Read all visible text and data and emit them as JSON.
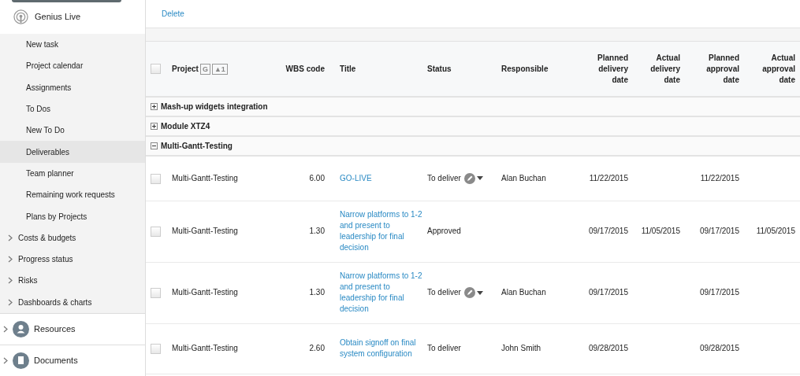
{
  "sidebar": {
    "app": {
      "label": "Genius Live"
    },
    "items": [
      {
        "label": "New task",
        "selected": false
      },
      {
        "label": "Project calendar",
        "selected": false
      },
      {
        "label": "Assignments",
        "selected": false
      },
      {
        "label": "To Dos",
        "selected": false
      },
      {
        "label": "New To Do",
        "selected": false
      },
      {
        "label": "Deliverables",
        "selected": true
      },
      {
        "label": "Team planner",
        "selected": false
      },
      {
        "label": "Remaining work requests",
        "selected": false
      },
      {
        "label": "Plans by Projects",
        "selected": false
      }
    ],
    "sections": [
      {
        "label": "Costs & budgets",
        "expanded": false
      },
      {
        "label": "Progress status",
        "expanded": false
      },
      {
        "label": "Risks",
        "expanded": false
      },
      {
        "label": "Dashboards & charts",
        "expanded": false
      }
    ],
    "modules": [
      {
        "label": "Resources",
        "kind": "person",
        "expanded": false
      },
      {
        "label": "Documents",
        "kind": "document",
        "expanded": false
      }
    ]
  },
  "toolbar": {
    "actions": [
      "Delete"
    ]
  },
  "table": {
    "select_all_checked": false,
    "columns": [
      {
        "label": "Project",
        "badges": [
          "G",
          "▲1"
        ]
      },
      {
        "label": "WBS code"
      },
      {
        "label": "Title"
      },
      {
        "label": "Status"
      },
      {
        "label": "Responsible"
      },
      {
        "label": "Planned delivery date"
      },
      {
        "label": "Actual delivery date"
      },
      {
        "label": "Planned approval date"
      },
      {
        "label": "Actual approval date"
      }
    ],
    "groups": [
      {
        "label": "Mash-up widgets integration",
        "expanded": false
      },
      {
        "label": "Module XTZ4",
        "expanded": false
      },
      {
        "label": "Multi-Gantt-Testing",
        "expanded": true,
        "rows": [
          {
            "checked": false,
            "project": "Multi-Gantt-Testing",
            "wbs_code": "6.00",
            "title": "GO-LIVE",
            "status": "To deliver",
            "status_editable": true,
            "responsible": "Alan Buchan",
            "planned_delivery": "11/22/2015",
            "actual_delivery": "",
            "planned_approval": "11/22/2015",
            "actual_approval": ""
          },
          {
            "checked": false,
            "project": "Multi-Gantt-Testing",
            "wbs_code": "1.30",
            "title": "Narrow platforms to 1-2 and present to leadership for final decision",
            "status": "Approved",
            "status_editable": false,
            "responsible": "",
            "planned_delivery": "09/17/2015",
            "actual_delivery": "11/05/2015",
            "planned_approval": "09/17/2015",
            "actual_approval": "11/05/2015"
          },
          {
            "checked": false,
            "project": "Multi-Gantt-Testing",
            "wbs_code": "1.30",
            "title": "Narrow platforms to 1-2 and present to leadership for final decision",
            "status": "To deliver",
            "status_editable": true,
            "responsible": "Alan Buchan",
            "planned_delivery": "09/17/2015",
            "actual_delivery": "",
            "planned_approval": "09/17/2015",
            "actual_approval": ""
          },
          {
            "checked": false,
            "project": "Multi-Gantt-Testing",
            "wbs_code": "2.60",
            "title": "Obtain signoff on final system configuration",
            "status": "To deliver",
            "status_editable": false,
            "responsible": "John Smith",
            "planned_delivery": "09/28/2015",
            "actual_delivery": "",
            "planned_approval": "09/28/2015",
            "actual_approval": ""
          }
        ]
      }
    ]
  }
}
